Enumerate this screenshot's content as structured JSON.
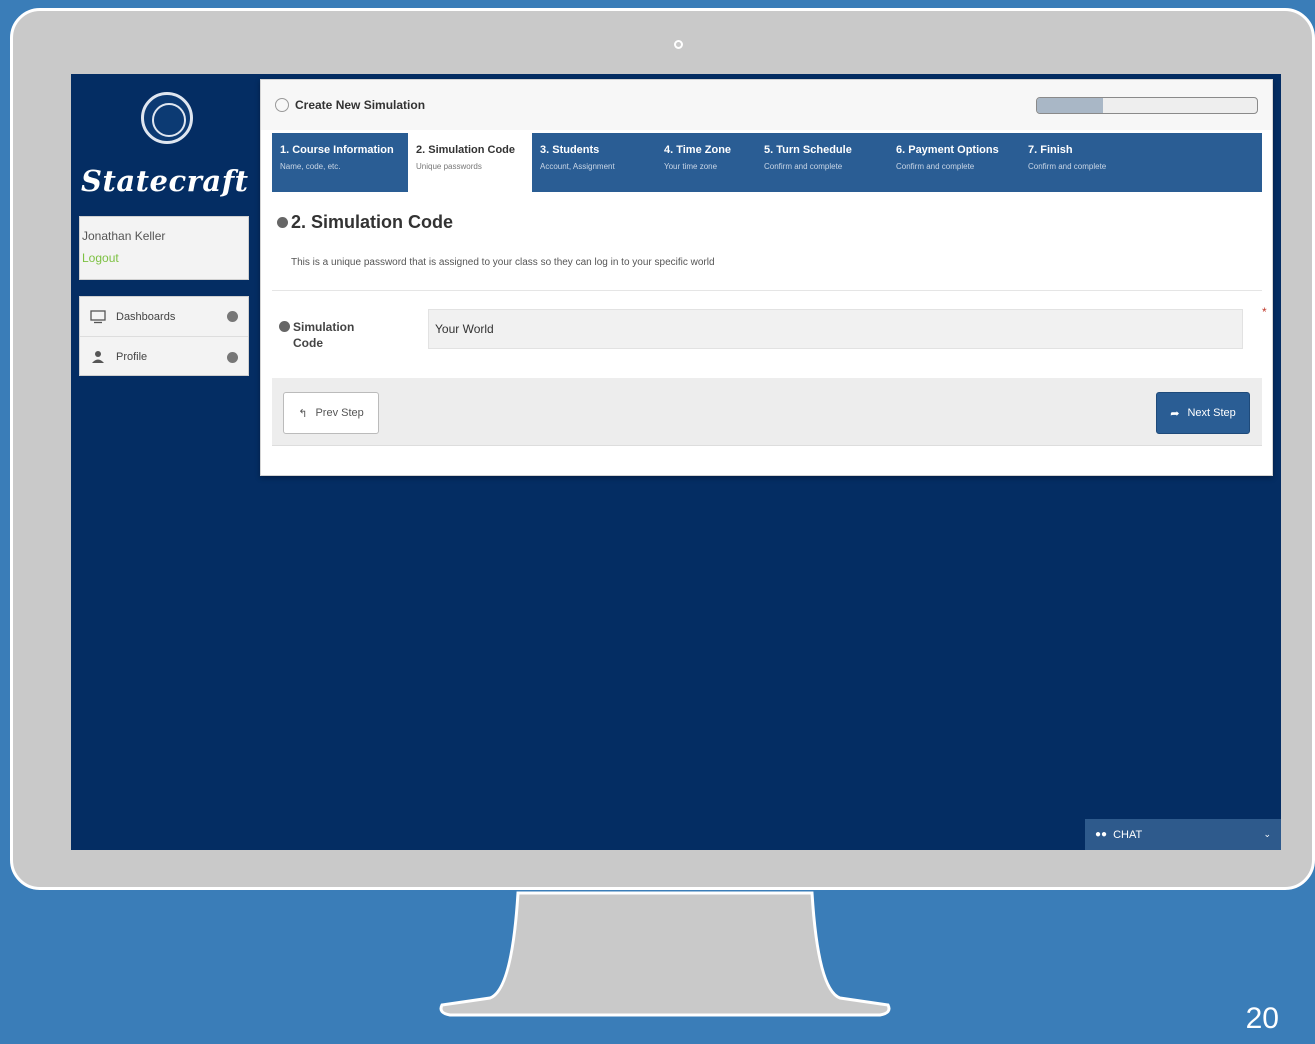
{
  "app": {
    "brand": "Statecraft"
  },
  "user": {
    "name": "Jonathan Keller",
    "logout_label": "Logout"
  },
  "sidebar": {
    "items": [
      {
        "label": "Dashboards",
        "icon": "monitor-icon"
      },
      {
        "label": "Profile",
        "icon": "user-icon"
      }
    ]
  },
  "panel": {
    "title": "Create New Simulation",
    "progress_fraction": 0.3
  },
  "steps": [
    {
      "title": "1. Course Information",
      "subtitle": "Name, code, etc."
    },
    {
      "title": "2. Simulation Code",
      "subtitle": "Unique passwords",
      "active": true
    },
    {
      "title": "3. Students",
      "subtitle": "Account, Assignment"
    },
    {
      "title": "4. Time Zone",
      "subtitle": "Your time zone"
    },
    {
      "title": "5. Turn Schedule",
      "subtitle": "Confirm and complete"
    },
    {
      "title": "6. Payment Options",
      "subtitle": "Confirm and complete"
    },
    {
      "title": "7. Finish",
      "subtitle": "Confirm and complete"
    }
  ],
  "section": {
    "title": "2. Simulation Code",
    "description": "This is a unique password that is assigned to your class so they can log in to your specific world"
  },
  "form": {
    "field_label_line1": "Simulation",
    "field_label_line2": "Code",
    "field_value": "Your World",
    "required_mark": "*"
  },
  "footer": {
    "prev_label": "Prev Step",
    "next_label": "Next Step"
  },
  "chat": {
    "label": "CHAT"
  },
  "slide": {
    "number": "20"
  },
  "colors": {
    "background": "#3a7db8",
    "screen": "#042d63",
    "step_bar": "#2a5d94",
    "logout_green": "#7dc142",
    "bezel": "#c9c9c9"
  }
}
